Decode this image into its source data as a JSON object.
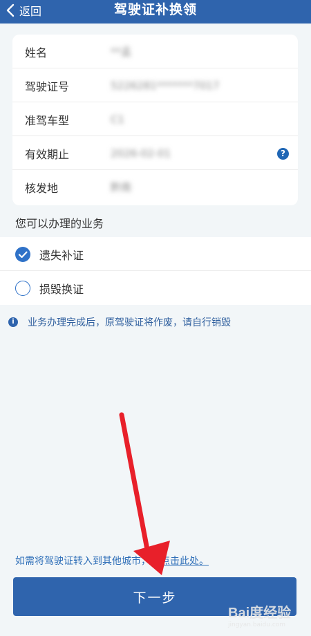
{
  "header": {
    "back_label": "返回",
    "title": "驾驶证补换领"
  },
  "info": {
    "rows": [
      {
        "label": "姓名",
        "value": "**孟"
      },
      {
        "label": "驾驶证号",
        "value": "5226281*******7017"
      },
      {
        "label": "准驾车型",
        "value": "C1"
      },
      {
        "label": "有效期止",
        "value": "2026-02-01"
      },
      {
        "label": "核发地",
        "value": "黔南"
      }
    ]
  },
  "section_title": "您可以办理的业务",
  "options": [
    {
      "label": "遗失补证",
      "checked": true
    },
    {
      "label": "损毁换证",
      "checked": false
    }
  ],
  "notice_text": "业务办理完成后，原驾驶证将作废，请自行销毁",
  "transfer": {
    "prefix": "如需将驾驶证转入到其他城市，",
    "link": "请点击此处。"
  },
  "next_button": "下一步",
  "watermark": {
    "logo": "Bai度经验",
    "sub": "jingyan.baidu.com"
  },
  "colors": {
    "brand": "#2f64ad",
    "accent": "#2f72c8",
    "annotation_arrow": "#e8202a"
  }
}
